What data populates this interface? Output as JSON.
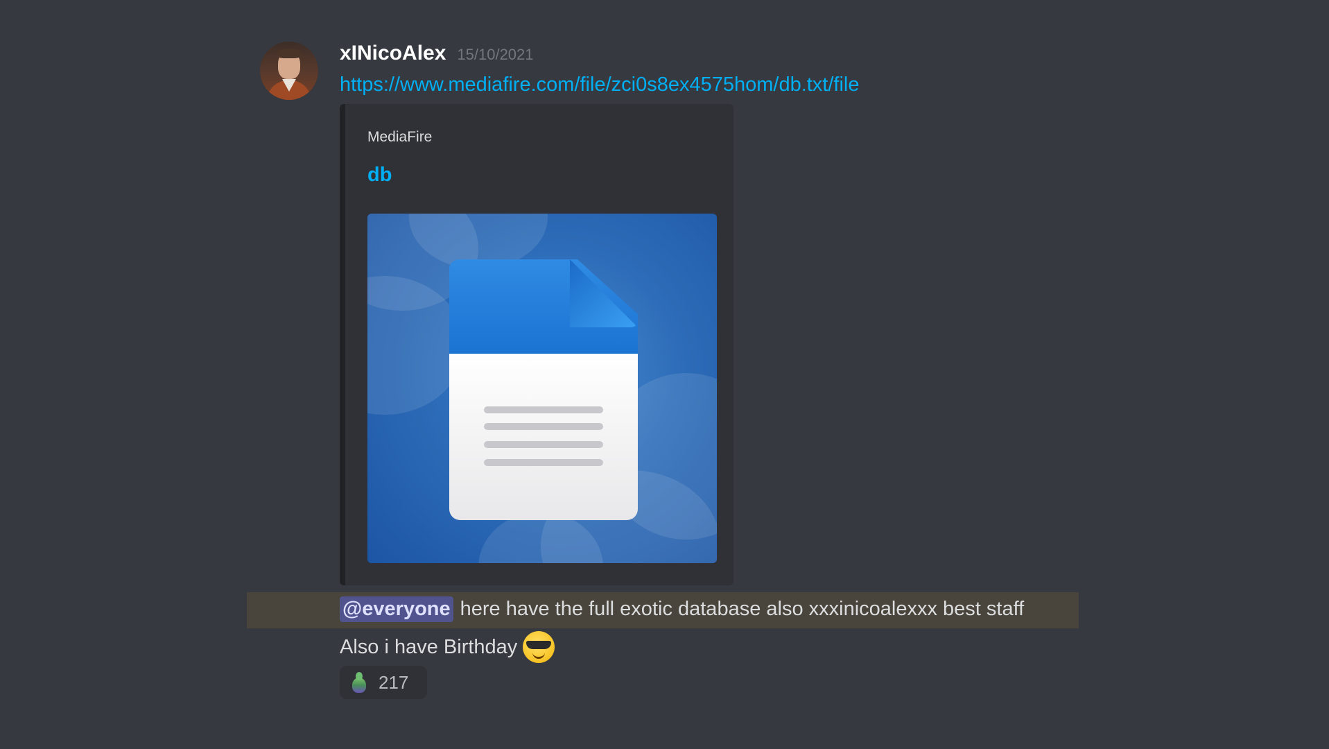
{
  "message": {
    "username": "xINicoAlex",
    "timestamp": "15/10/2021",
    "link": "https://www.mediafire.com/file/zci0s8ex4575hom/db.txt/file"
  },
  "embed": {
    "provider": "MediaFire",
    "title": "db",
    "image_icon": "text-file-icon"
  },
  "followups": {
    "mention": "@everyone",
    "mention_message": "here have the full exotic database also xxxinicoalexxx best staff",
    "birthday_message": "Also i have Birthday",
    "birthday_emoji": "sunglasses-emoji"
  },
  "reaction": {
    "icon": "pepe-emoji",
    "count": "217"
  },
  "colors": {
    "background": "#36393f",
    "link": "#00aff4",
    "embed_background": "#2f3136",
    "mention_highlight": "#49443c"
  }
}
